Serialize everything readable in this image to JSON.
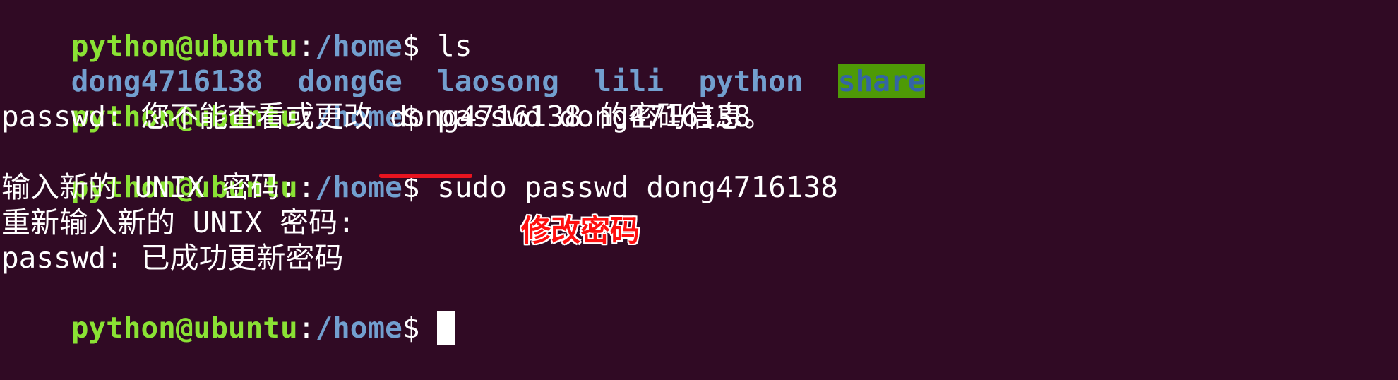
{
  "terminal": {
    "prompt_user": "python@ubuntu",
    "prompt_colon": ":",
    "prompt_path": "/home",
    "prompt_dollar": "$",
    "line1_command": " ls",
    "ls_output": {
      "item1": "dong4716138",
      "item2": "dongGe",
      "item3": "laosong",
      "item4": "lili",
      "item5": "python",
      "item6": "share"
    },
    "line3_command": " passwd dong4716138",
    "line4_output": "passwd: 您不能查看或更改 dong4716138 的密码信息。",
    "line5_command_prefix": " ",
    "line5_sudo": "sudo",
    "line5_command_rest": " passwd dong4716138",
    "line6_output": "输入新的 UNIX 密码:",
    "line7_output": "重新输入新的 UNIX 密码:",
    "line8_output": "passwd: 已成功更新密码",
    "line9_command": " "
  },
  "annotation": {
    "text": "修改密码",
    "color": "#ff1010"
  },
  "colors": {
    "background": "#300a24",
    "user": "#8ae234",
    "path": "#729fcf",
    "sticky_dir_bg": "#4e9a06",
    "underline": "#e8141f"
  }
}
